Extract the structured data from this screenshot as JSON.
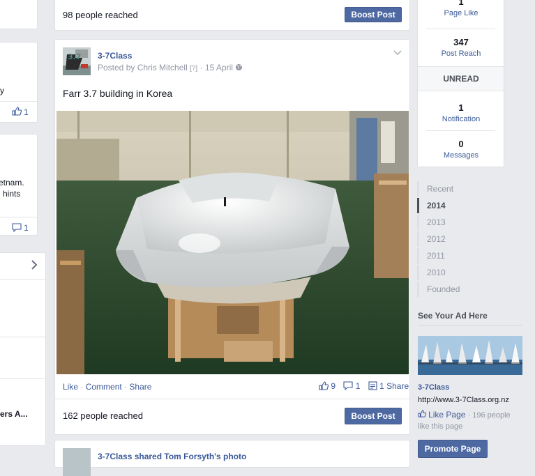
{
  "top_post": {
    "reach": "98 people reached",
    "boost": "Boost Post"
  },
  "left_col": {
    "c1_text": "y",
    "c1_count": "1",
    "c2_line1": "etnam.",
    "c2_line2": "l hints",
    "c2_count": "1",
    "c3_text": "ers A..."
  },
  "post": {
    "page_name": "3-7Class",
    "posted_by_prefix": "Posted by",
    "author": "Chris Mitchell",
    "help": "[?]",
    "sep": "·",
    "date": "15 April",
    "text": "Farr 3.7 building in Korea",
    "like": "Like",
    "comment": "Comment",
    "share": "Share",
    "likes_count": "9",
    "comments_count": "1",
    "shares": "1 Share",
    "reach": "162 people reached",
    "boost": "Boost Post"
  },
  "next_post": {
    "partial_text": "3-7Class shared Tom Forsyth's photo"
  },
  "stats": {
    "page_like_num": "1",
    "page_like_label": "Page Like",
    "reach_num": "347",
    "reach_label": "Post Reach",
    "unread": "UNREAD",
    "notif_num": "1",
    "notif_label": "Notification",
    "msg_num": "0",
    "msg_label": "Messages"
  },
  "timeline": [
    "Recent",
    "2014",
    "2013",
    "2012",
    "2011",
    "2010",
    "Founded"
  ],
  "ad": {
    "heading": "See Your Ad Here",
    "name": "3-7Class",
    "url": "http://www.3-7Class.org.nz",
    "like_page": "Like Page",
    "dot": "·",
    "likes": "196 people like this page",
    "promote": "Promote Page"
  },
  "colors": {
    "link": "#3b5998",
    "button": "#4e69a2",
    "bg": "#e9eaed"
  }
}
